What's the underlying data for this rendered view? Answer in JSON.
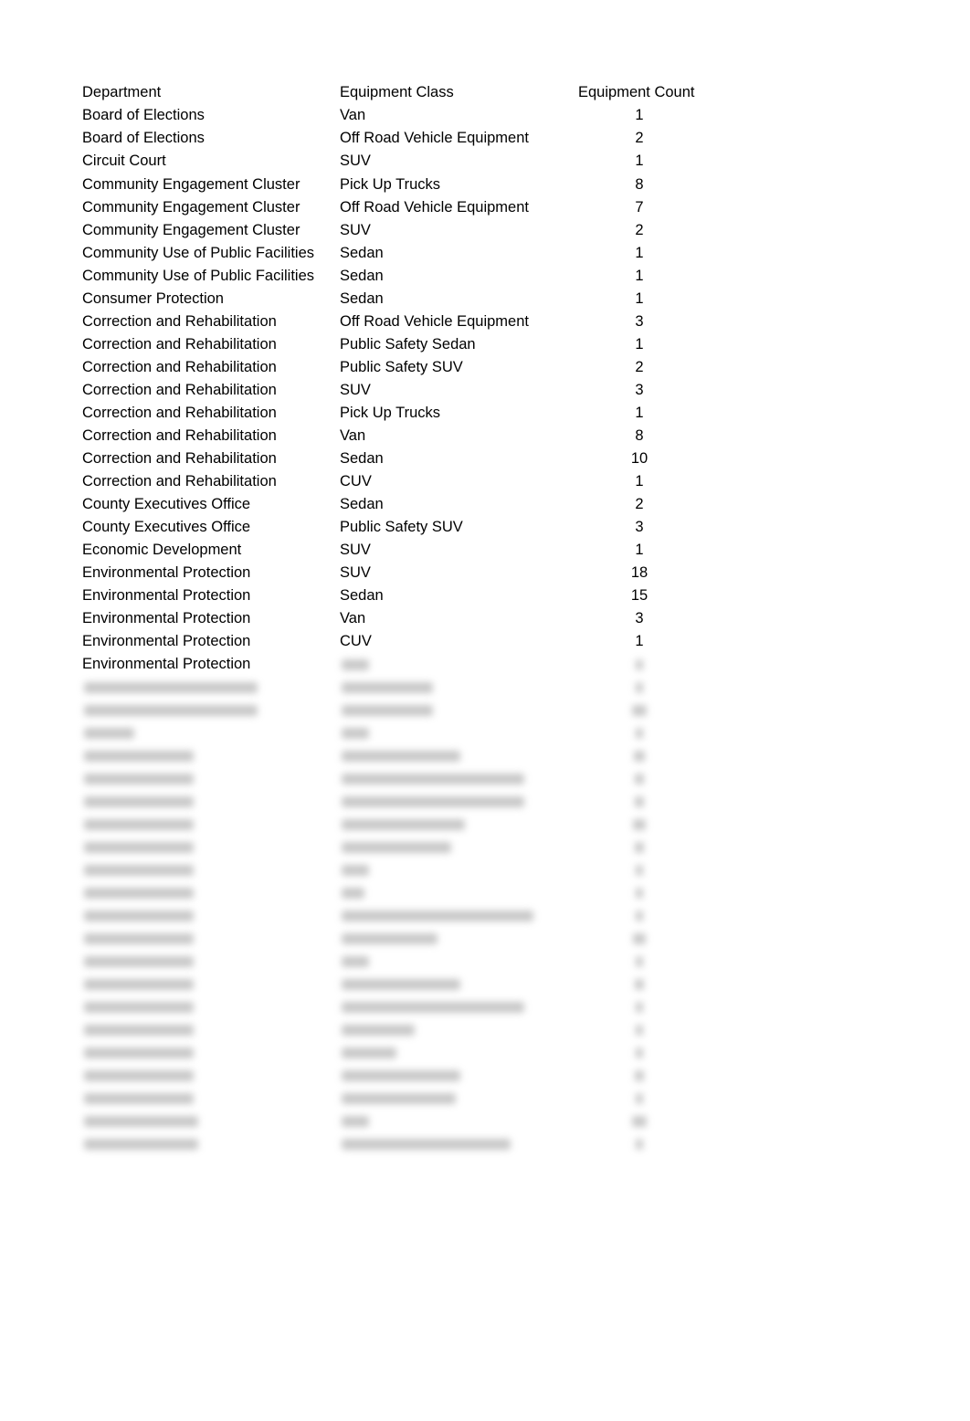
{
  "table": {
    "headers": [
      "Department",
      "Equipment Class",
      "Equipment Count"
    ],
    "rows": [
      [
        "Board of Elections",
        "Van",
        "1"
      ],
      [
        "Board of Elections",
        "Off Road Vehicle Equipment",
        "2"
      ],
      [
        "Circuit Court",
        "SUV",
        "1"
      ],
      [
        "Community Engagement Cluster",
        "Pick Up Trucks",
        "8"
      ],
      [
        "Community Engagement Cluster",
        "Off Road Vehicle Equipment",
        "7"
      ],
      [
        "Community Engagement Cluster",
        "SUV",
        "2"
      ],
      [
        "Community Use of Public Facilities",
        "Sedan",
        "1"
      ],
      [
        "Community Use of Public Facilities",
        "Sedan",
        "1"
      ],
      [
        "Consumer Protection",
        "Sedan",
        "1"
      ],
      [
        "Correction and Rehabilitation",
        "Off Road Vehicle Equipment",
        "3"
      ],
      [
        "Correction and Rehabilitation",
        "Public Safety Sedan",
        "1"
      ],
      [
        "Correction and Rehabilitation",
        "Public Safety SUV",
        "2"
      ],
      [
        "Correction and Rehabilitation",
        "SUV",
        "3"
      ],
      [
        "Correction and Rehabilitation",
        "Pick Up Trucks",
        "1"
      ],
      [
        "Correction and Rehabilitation",
        "Van",
        "8"
      ],
      [
        "Correction and Rehabilitation",
        "Sedan",
        "10"
      ],
      [
        "Correction and Rehabilitation",
        "CUV",
        "1"
      ],
      [
        "County Executives Office",
        "Sedan",
        "2"
      ],
      [
        "County Executives Office",
        "Public Safety SUV",
        "3"
      ],
      [
        "Economic Development",
        "SUV",
        "1"
      ],
      [
        "Environmental Protection",
        "SUV",
        "18"
      ],
      [
        "Environmental Protection",
        "Sedan",
        "15"
      ],
      [
        "Environmental Protection",
        "Van",
        "3"
      ],
      [
        "Environmental Protection",
        "CUV",
        "1"
      ],
      [
        "Environmental Protection",
        "",
        ""
      ]
    ],
    "blurred_rows_note": "remaining rows obscured"
  }
}
